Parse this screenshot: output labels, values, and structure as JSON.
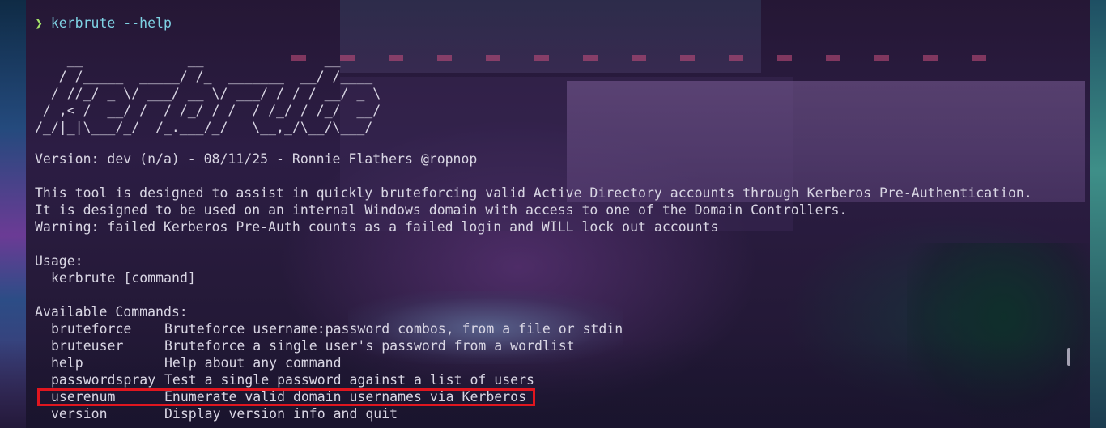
{
  "prompt": {
    "symbol": "❯",
    "command": "kerbrute --help"
  },
  "banner": [
    "    __             __               __     ",
    "   / /_____  _____/ /_  _______  __/ /____ ",
    "  / //_/ _ \\/ ___/ __ \\/ ___/ / / / __/ _ \\",
    " / ,< /  __/ /  / /_/ / /  / /_/ / /_/  __/",
    "/_/|_|\\___/_/  /_.___/_/   \\__,_/\\__/\\___/ "
  ],
  "version_line": "Version: dev (n/a) - 08/11/25 - Ronnie Flathers @ropnop",
  "description": [
    "This tool is designed to assist in quickly bruteforcing valid Active Directory accounts through Kerberos Pre-Authentication.",
    "It is designed to be used on an internal Windows domain with access to one of the Domain Controllers.",
    "Warning: failed Kerberos Pre-Auth counts as a failed login and WILL lock out accounts"
  ],
  "usage": {
    "heading": "Usage:",
    "syntax": "kerbrute [command]"
  },
  "commands": {
    "heading": "Available Commands:",
    "items": [
      {
        "name": "bruteforce",
        "description": "Bruteforce username:password combos, from a file or stdin"
      },
      {
        "name": "bruteuser",
        "description": "Bruteforce a single user's password from a wordlist"
      },
      {
        "name": "help",
        "description": "Help about any command"
      },
      {
        "name": "passwordspray",
        "description": "Test a single password against a list of users"
      },
      {
        "name": "userenum",
        "description": "Enumerate valid domain usernames via Kerberos"
      },
      {
        "name": "version",
        "description": "Display version info and quit"
      }
    ]
  },
  "colors": {
    "prompt_arrow": "#a6e36a",
    "prompt_command": "#7fd2e4",
    "text": "#d9d6e4",
    "highlight_border": "#e0161f"
  },
  "highlighted_command": "userenum"
}
